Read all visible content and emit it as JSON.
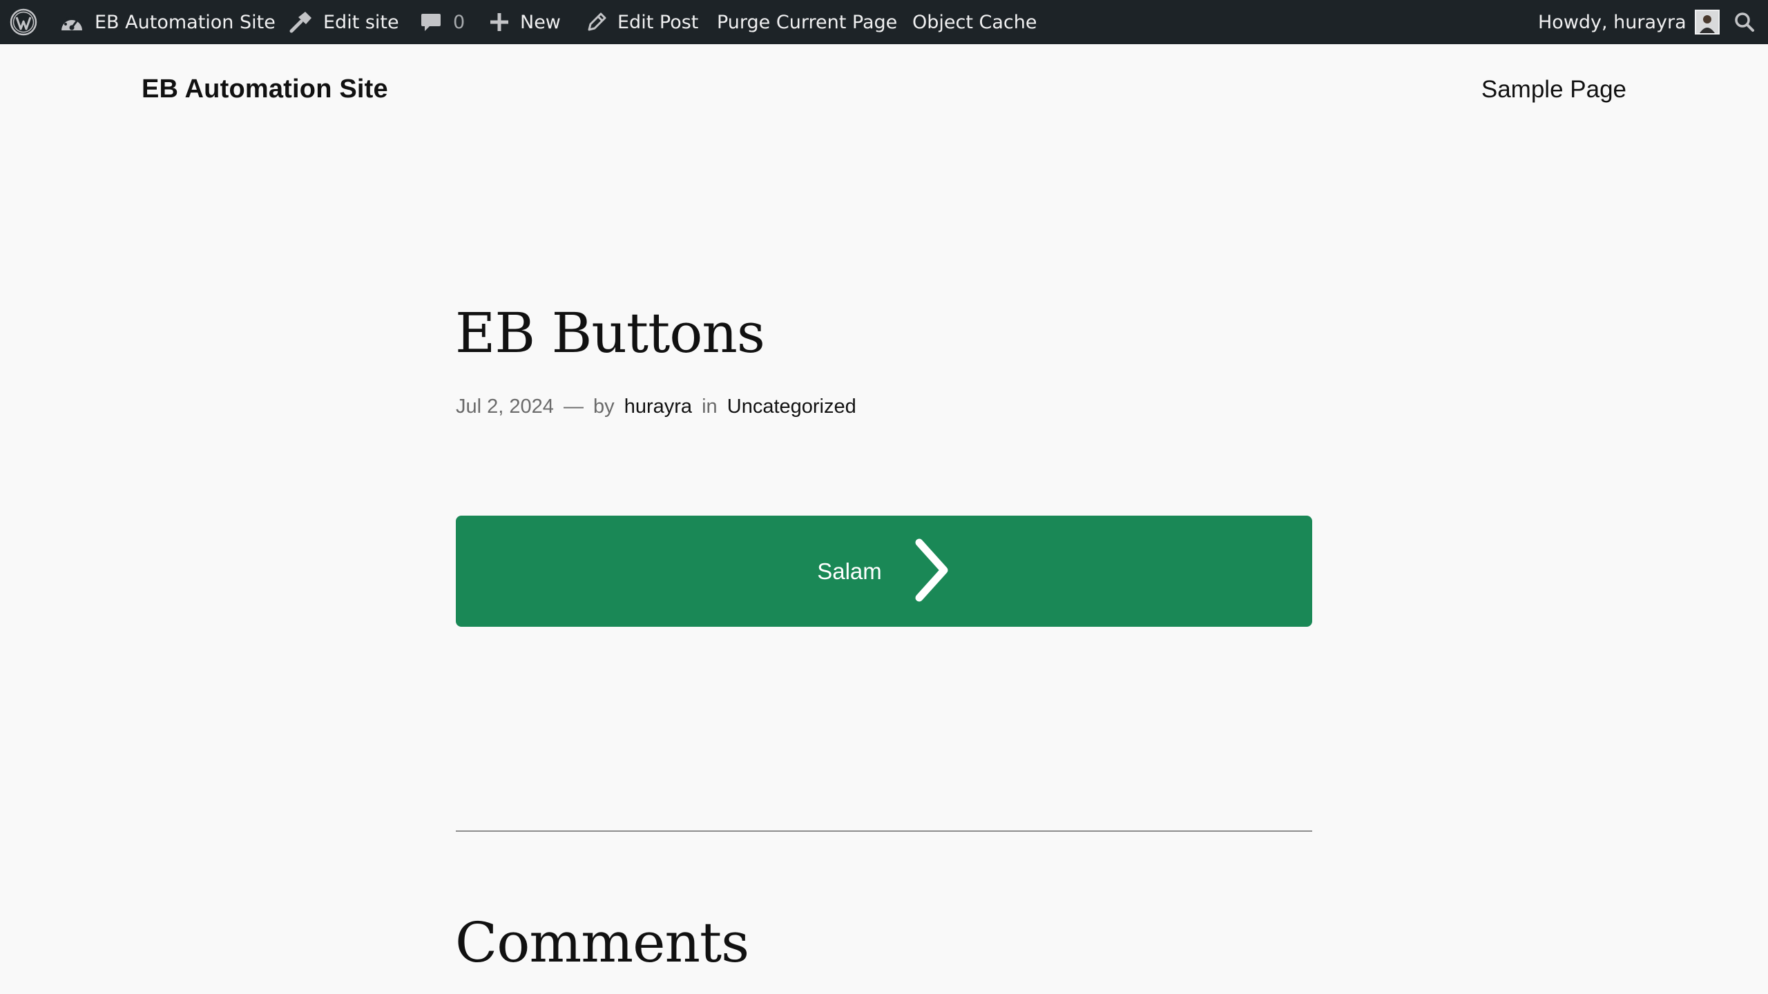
{
  "admin_bar": {
    "wp_logo_icon": "wordpress-logo-icon",
    "site_name": "EB Automation Site",
    "site_icon": "dashboard-icon",
    "edit_site": "Edit site",
    "edit_site_icon": "hammer-icon",
    "comments_count": "0",
    "comments_icon": "speech-bubble-icon",
    "new": "New",
    "new_icon": "plus-icon",
    "edit_post": "Edit Post",
    "edit_post_icon": "pencil-icon",
    "purge": "Purge Current Page",
    "object_cache": "Object Cache",
    "howdy": "Howdy, hurayra",
    "search_icon": "search-icon",
    "colors": {
      "background": "#1d2327",
      "text": "#f0f0f1",
      "muted": "#a7aaad"
    }
  },
  "header": {
    "site_title": "EB Automation Site",
    "nav": [
      "Sample Page"
    ]
  },
  "post": {
    "title": "EB Buttons",
    "date": "Jul 2, 2024",
    "dash": "—",
    "by": "by",
    "author": "hurayra",
    "in": "in",
    "category": "Uncategorized"
  },
  "button": {
    "label": "Salam",
    "icon": "chevron-right-icon",
    "color": "#1a8856"
  },
  "comments": {
    "title": "Comments"
  },
  "colors": {
    "page_background": "#f9f9f9",
    "text": "#111111",
    "meta_text": "#6a6a6a"
  }
}
